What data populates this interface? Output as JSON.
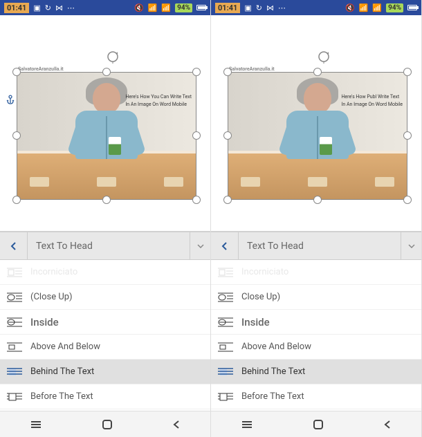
{
  "status": {
    "time": "01:41",
    "battery_pct": "94%"
  },
  "doc": {
    "watermark": "SalvatoreAranzulla.it",
    "overlay": {
      "left": {
        "line1": "Here's How You Can Write Text",
        "line2": "In An Image On Word Mobile"
      },
      "right": {
        "line1": "Here's How Publ Write Text",
        "line2": "In An Image On Word Mobile"
      }
    }
  },
  "toolbar": {
    "title": "Text To Head"
  },
  "options": {
    "incorniciato": "Incorniciato",
    "close_up_left": "(Close Up)",
    "close_up_right": "Close Up)",
    "inside": "Inside",
    "above_below_left": "Above And Below",
    "above_below_right": "Above And Below",
    "behind_left": "Behind The Text",
    "behind_right": "Behind The Text",
    "before": "Before The Text"
  },
  "icons": {
    "square_lines": "wrap-square",
    "tight_lines": "wrap-tight",
    "behind_lines": "wrap-behind",
    "front_lines": "wrap-front"
  }
}
